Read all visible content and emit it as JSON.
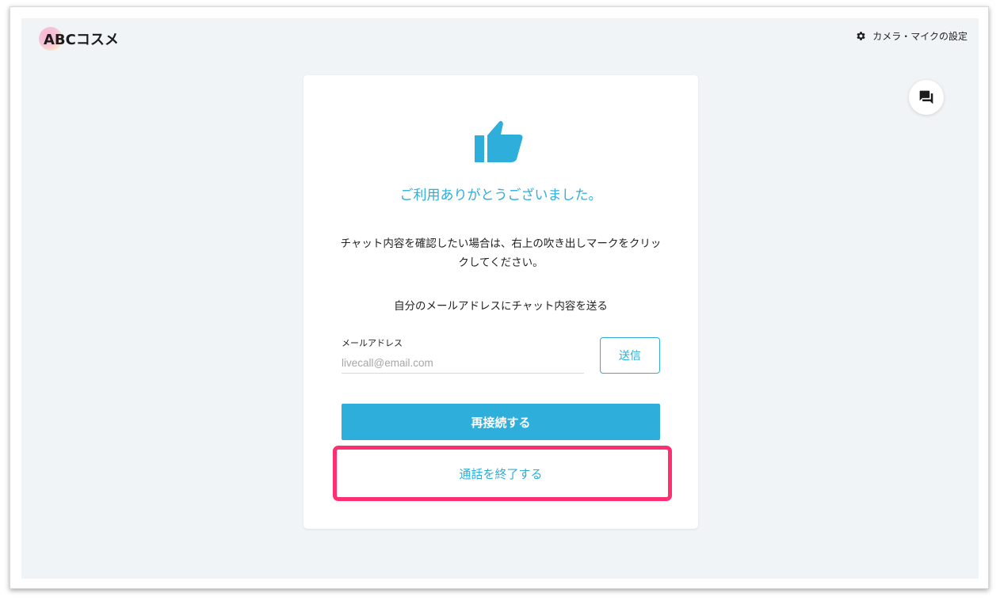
{
  "header": {
    "logo_text": "ABCコスメ",
    "settings_label": "カメラ・マイクの設定"
  },
  "card": {
    "thanks_message": "ご利用ありがとうございました。",
    "description": "チャット内容を確認したい場合は、右上の吹き出しマークをクリックしてください。",
    "send_title": "自分のメールアドレスにチャット内容を送る",
    "email": {
      "label": "メールアドレス",
      "placeholder": "livecall@email.com",
      "value": ""
    },
    "send_button": "送信",
    "reconnect_button": "再接続する",
    "end_call_button": "通話を終了する"
  },
  "colors": {
    "accent": "#2daedb",
    "highlight": "#ff2f72",
    "background": "#f1f4f7"
  },
  "icons": {
    "settings": "gear-icon",
    "chat": "chat-bubbles-icon",
    "success": "thumbs-up-icon"
  }
}
